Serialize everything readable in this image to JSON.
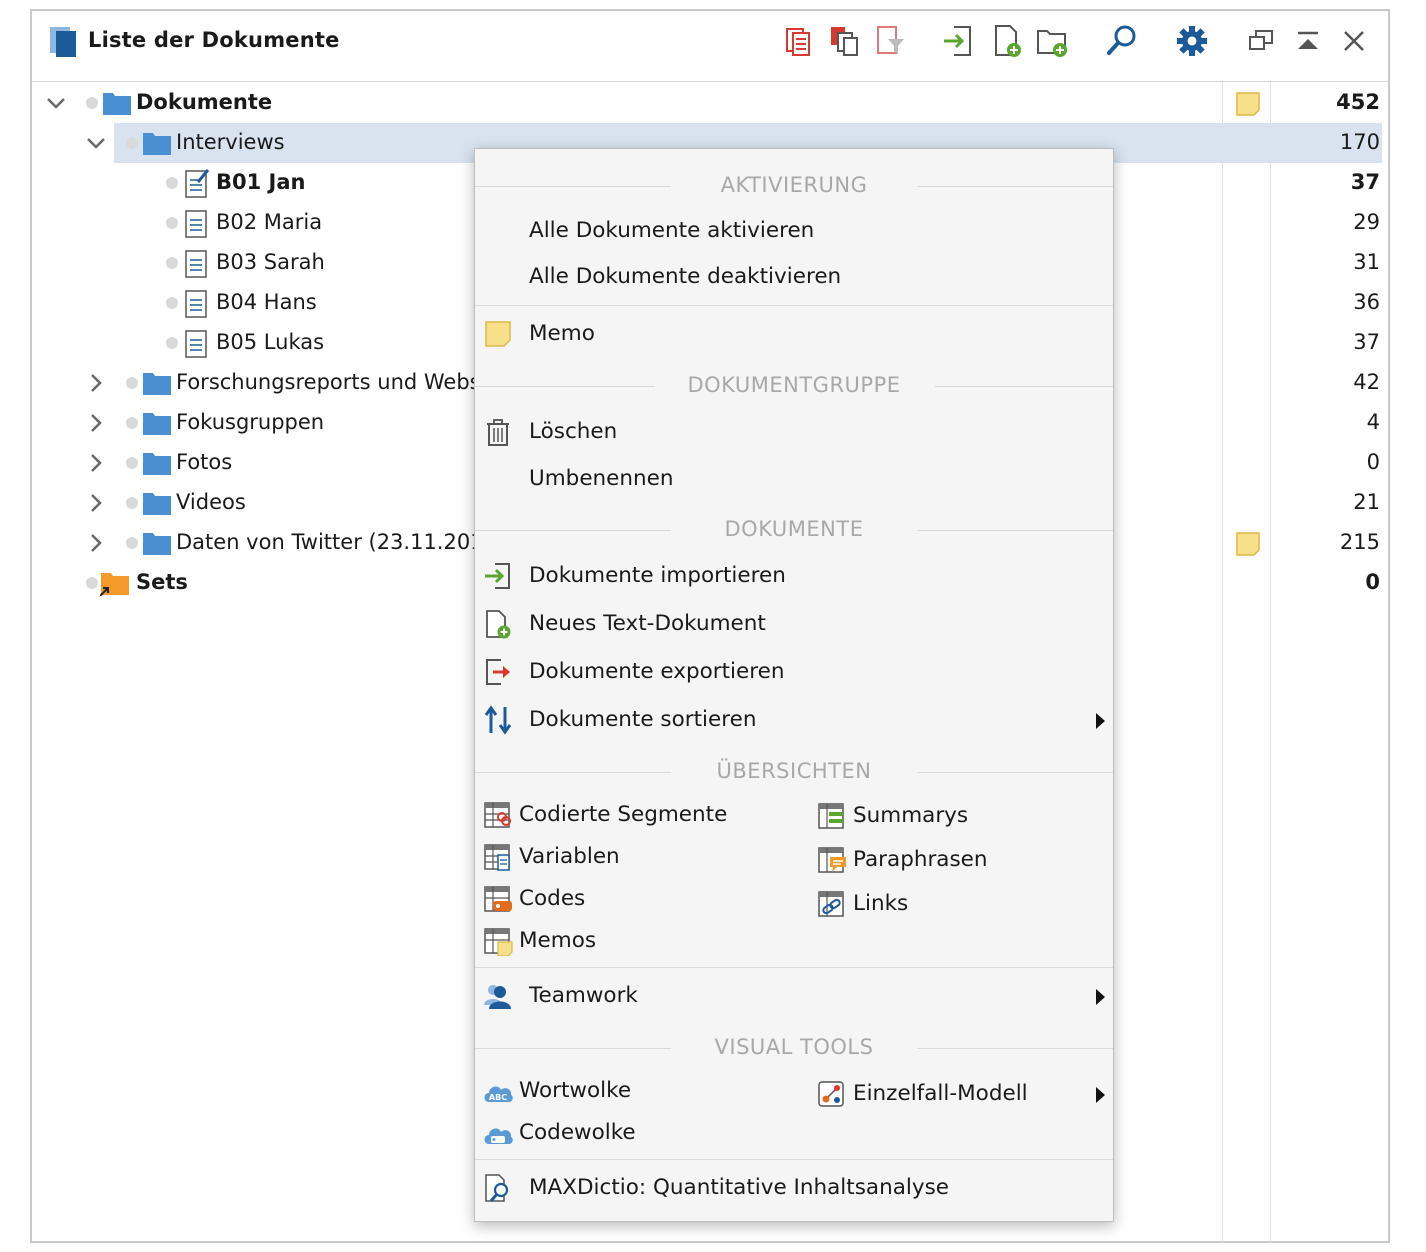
{
  "window": {
    "title": "Liste der Dokumente",
    "toolbar_icons": [
      "activate-all-icon",
      "copy-activated-icon",
      "filter-activated-icon",
      "import-documents-icon",
      "new-text-document-icon",
      "new-document-group-icon",
      "search-icon",
      "settings-gear-icon",
      "undock-window-icon",
      "collapse-window-icon",
      "close-icon"
    ]
  },
  "tree": {
    "rows": [
      {
        "label": "Dokumente",
        "count": "452"
      },
      {
        "label": "Interviews",
        "count": "170"
      },
      {
        "label": "B01 Jan",
        "count": "37"
      },
      {
        "label": "B02 Maria",
        "count": "29"
      },
      {
        "label": "B03 Sarah",
        "count": "31"
      },
      {
        "label": "B04 Hans",
        "count": "36"
      },
      {
        "label": "B05 Lukas",
        "count": "37"
      },
      {
        "label": "Forschungsreports und Webs",
        "count": "42"
      },
      {
        "label": "Fokusgruppen",
        "count": "4"
      },
      {
        "label": "Fotos",
        "count": "0"
      },
      {
        "label": "Videos",
        "count": "21"
      },
      {
        "label": "Daten von Twitter (23.11.201",
        "count": "215"
      },
      {
        "label": "Sets",
        "count": "0"
      }
    ]
  },
  "context_menu": {
    "sections": {
      "aktivierung": "AKTIVIERUNG",
      "dokumentgruppe": "DOKUMENTGRUPPE",
      "dokumente": "DOKUMENTE",
      "uebersichten": "ÜBERSICHTEN",
      "visual_tools": "VISUAL TOOLS"
    },
    "items": {
      "activate_all": "Alle Dokumente aktivieren",
      "deactivate_all": "Alle Dokumente deaktivieren",
      "memo": "Memo",
      "delete": "Löschen",
      "rename": "Umbenennen",
      "import": "Dokumente importieren",
      "new_text": "Neues Text-Dokument",
      "export": "Dokumente exportieren",
      "sort": "Dokumente sortieren",
      "coded_segments": "Codierte Segmente",
      "summarys": "Summarys",
      "variables": "Variablen",
      "paraphrases": "Paraphrasen",
      "codes": "Codes",
      "links": "Links",
      "memos": "Memos",
      "teamwork": "Teamwork",
      "wordcloud": "Wortwolke",
      "single_case_model": "Einzelfall-Modell",
      "codecloud": "Codewolke",
      "maxdictio": "MAXDictio: Quantitative Inhaltsanalyse"
    }
  },
  "colors": {
    "folder_blue": "#4a8fd2",
    "sets_orange": "#f39a2b",
    "selection": "#d8e3ef",
    "memo_yellow": "#f8e08a",
    "icon_red": "#d63a2f",
    "icon_green": "#5aa62f",
    "icon_blue": "#1d5a9a"
  }
}
